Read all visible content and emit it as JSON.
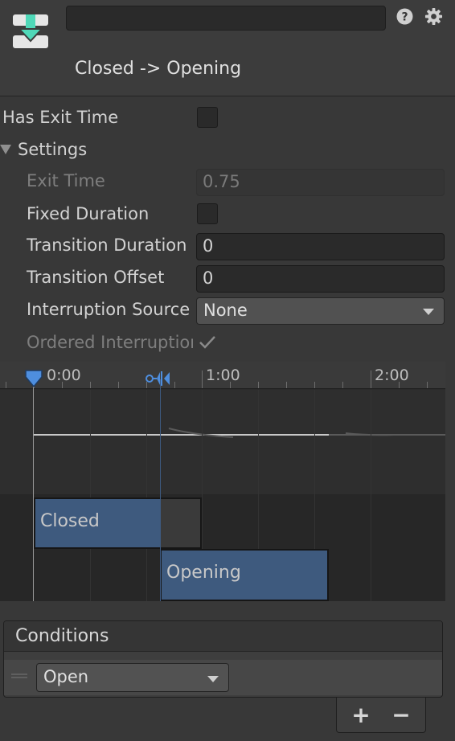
{
  "header": {
    "title": "Closed -> Opening",
    "name_value": ""
  },
  "properties": {
    "has_exit_time": {
      "label": "Has Exit Time",
      "checked": false
    },
    "settings": {
      "label": "Settings",
      "expanded": true
    },
    "exit_time": {
      "label": "Exit Time",
      "value": "0.75",
      "enabled": false
    },
    "fixed_duration": {
      "label": "Fixed Duration",
      "checked": false
    },
    "transition_duration": {
      "label": "Transition Duration",
      "value": "0"
    },
    "transition_offset": {
      "label": "Transition Offset",
      "value": "0"
    },
    "interruption_source": {
      "label": "Interruption Source",
      "value": "None"
    },
    "ordered_interruption": {
      "label": "Ordered Interruption",
      "checked": true,
      "enabled": false
    }
  },
  "timeline": {
    "tick_labels": [
      "0:00",
      "1:00",
      "2:00"
    ],
    "clips": [
      {
        "name": "Closed"
      },
      {
        "name": "Opening"
      }
    ]
  },
  "conditions": {
    "title": "Conditions",
    "items": [
      {
        "parameter": "Open"
      }
    ],
    "add_label": "+",
    "remove_label": "−"
  },
  "colors": {
    "background": "#383838",
    "clip_blue": "#3e5a7e",
    "marker_blue": "#4e8ede",
    "icon_green": "#4fd8b8"
  },
  "icons": {
    "header": "transition-download-icon",
    "help": "help-icon",
    "settings": "gear-icon",
    "start_marker": "start-marker-icon",
    "transition_marker": "transition-marker-icon"
  }
}
